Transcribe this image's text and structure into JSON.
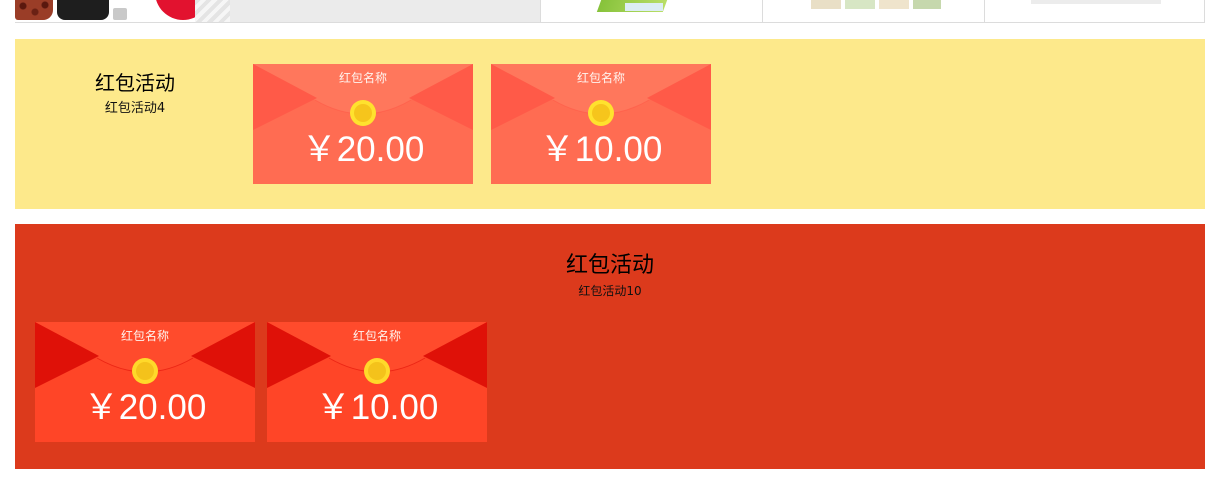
{
  "top_row": {
    "thumbnails": [
      {
        "icon": "coffee-appliance-image"
      },
      {
        "icon": "product-image"
      },
      {
        "icon": "green-product-image"
      },
      {
        "icon": "packaged-goods-image"
      },
      {
        "icon": "packaged-goods-image"
      }
    ]
  },
  "sections": [
    {
      "title": "红包活动",
      "subtitle": "红包活动4",
      "theme": {
        "background": "#FDE98B",
        "envelope_body": "#FF6C52",
        "envelope_flap": "#FF775C",
        "envelope_side": "#FF5A48",
        "coin_outer": "#FFE22E",
        "coin_inner": "#F6C51C"
      },
      "envelopes": [
        {
          "name": "红包名称",
          "amount": "￥20.00"
        },
        {
          "name": "红包名称",
          "amount": "￥10.00"
        }
      ]
    },
    {
      "title": "红包活动",
      "subtitle": "红包活动10",
      "theme": {
        "background": "#DC3A1C",
        "envelope_body": "#FF4527",
        "envelope_flap": "#FF4B2C",
        "envelope_side": "#DF1108",
        "coin_outer": "#FFD92A",
        "coin_inner": "#F4C21B"
      },
      "envelopes": [
        {
          "name": "红包名称",
          "amount": "￥20.00"
        },
        {
          "name": "红包名称",
          "amount": "￥10.00"
        }
      ]
    }
  ]
}
